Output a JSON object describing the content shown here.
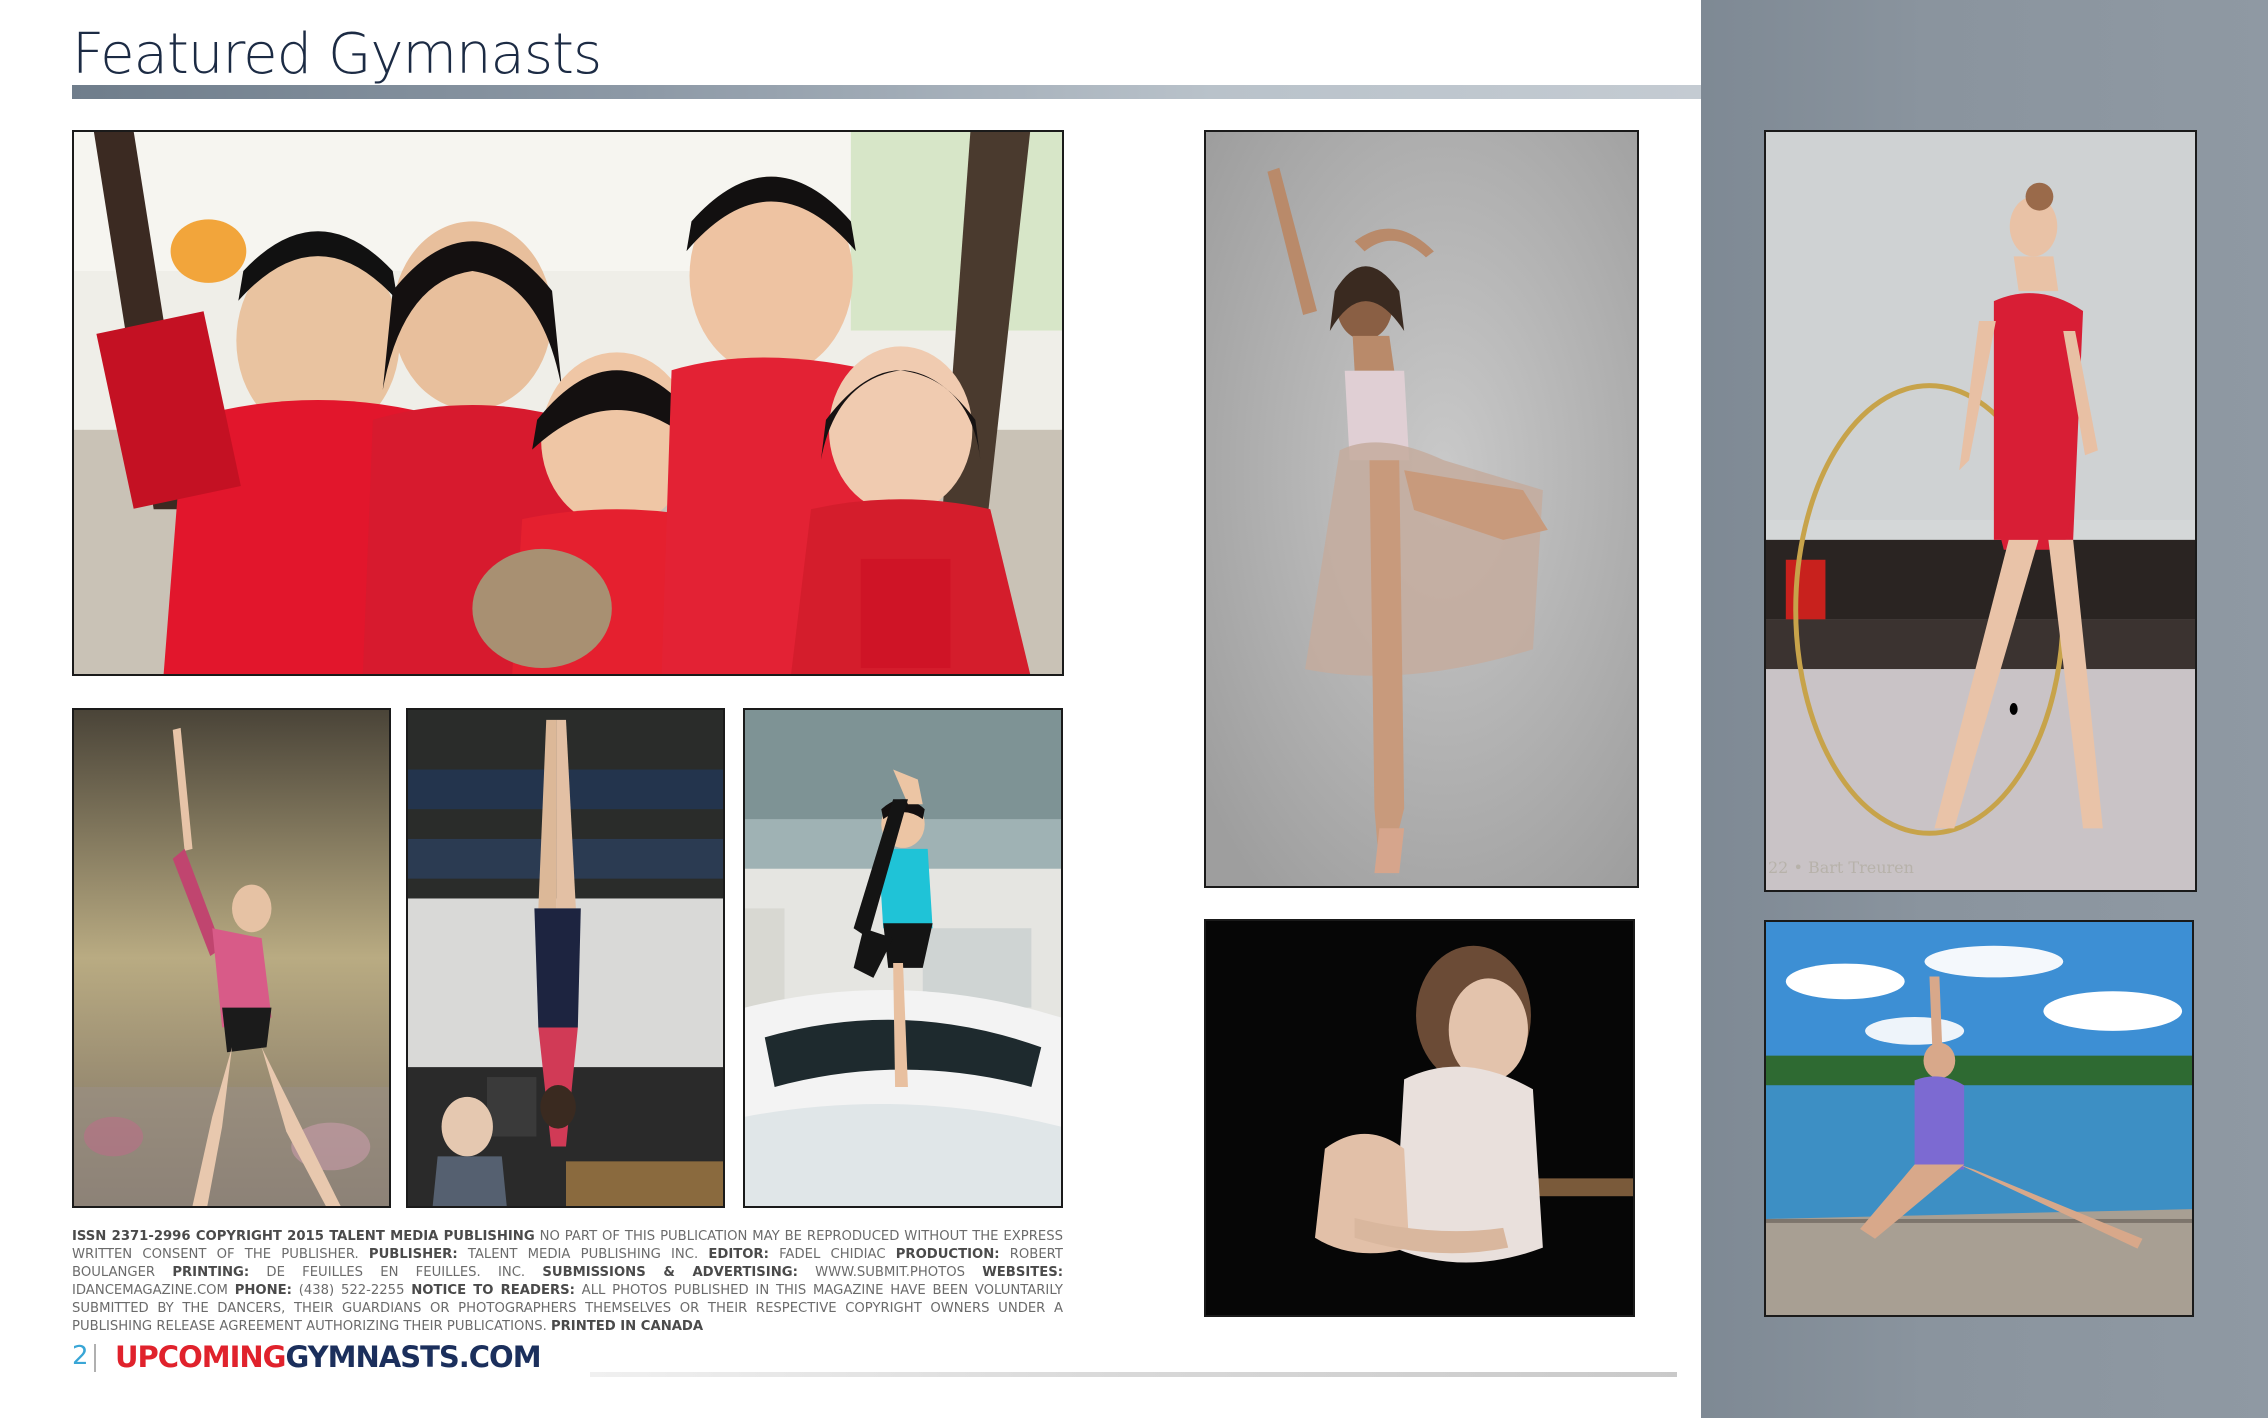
{
  "page": {
    "title": "Featured Gymnasts",
    "page_number": "2",
    "brand_part1": "UPCOMING",
    "brand_part2": "GYMNASTS.COM"
  },
  "photo_credit": "22 • Bart Treuren",
  "credits": {
    "issn_label": "ISSN 2371-2996 COPYRIGHT 2015 TALENT MEDIA PUBLISHING",
    "notice": "NO PART OF THIS PUBLICATION MAY BE REPRODUCED WITHOUT THE EXPRESS WRITTEN CONSENT OF THE PUBLISHER.",
    "publisher_label": "PUBLISHER:",
    "publisher": "TALENT MEDIA PUBLISHING INC.",
    "editor_label": "EDITOR:",
    "editor": "FADEL CHIDIAC",
    "production_label": "PRODUCTION:",
    "production": "ROBERT BOULANGER",
    "printing_label": "PRINTING:",
    "printing": "DE FEUILLES EN FEUILLES. INC.",
    "submissions_label": "SUBMISSIONS & ADVERTISING:",
    "submissions": "WWW.SUBMIT.PHOTOS",
    "websites_label": "WEBSITES:",
    "websites": "IDANCEMAGAZINE.COM",
    "phone_label": "PHONE:",
    "phone": "(438) 522-2255",
    "readers_label": "NOTICE TO READERS:",
    "readers": "ALL PHOTOS PUBLISHED IN THIS MAGAZINE HAVE BEEN VOLUNTARILY SUBMITTED BY THE DANCERS, THEIR GUARDIANS OR PHOTOGRAPHERS THEMSELVES OR THEIR RESPECTIVE COPYRIGHT OWNERS UNDER A PUBLISHING RELEASE AGREEMENT AUTHORIZING THEIR PUBLICATIONS.",
    "printed_label": "PRINTED IN CANADA"
  },
  "colors": {
    "title": "#1c2b44",
    "brand_red": "#e0222c",
    "brand_navy": "#1b2f5c",
    "page_number": "#39a6d6",
    "side_panel": "#8a949e"
  }
}
